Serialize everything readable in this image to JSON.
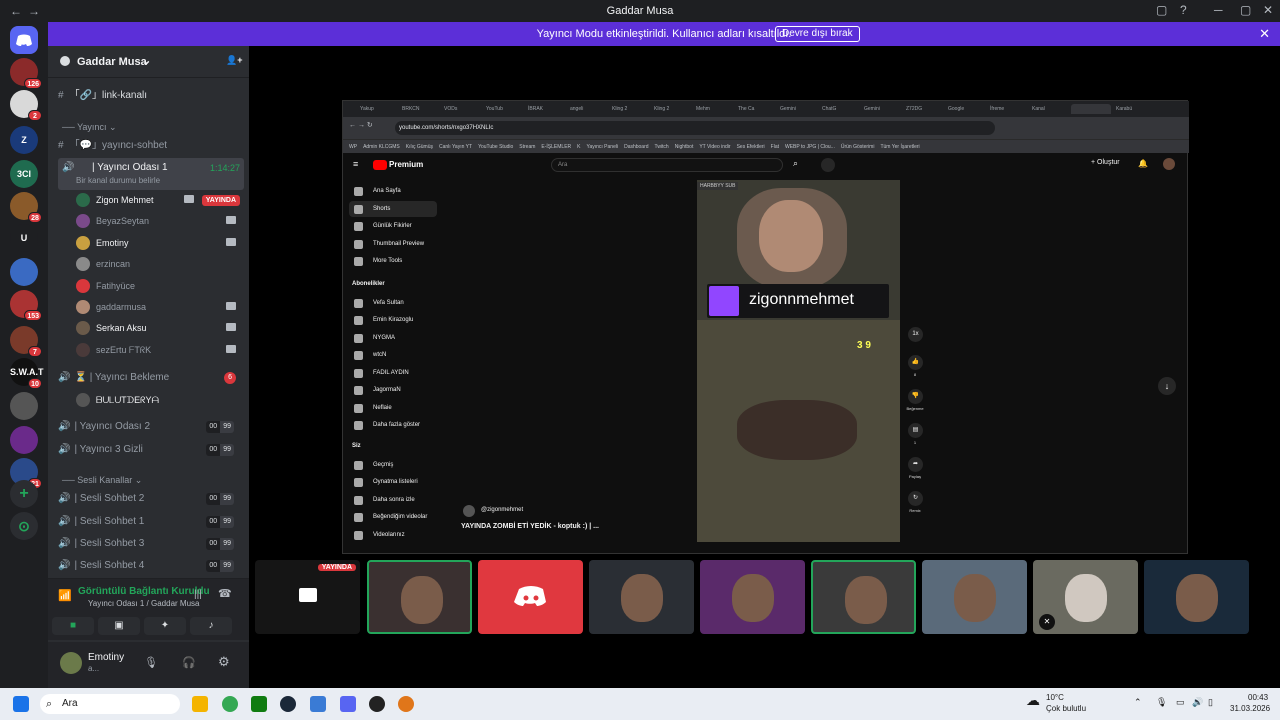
{
  "window": {
    "title": "Gaddar Musa",
    "back": "←",
    "forward": "→",
    "controls": [
      "▢",
      "?",
      "─",
      "▢",
      "✕"
    ]
  },
  "banner": {
    "text": "Yayıncı Modu etkinleştirildi. Kullanıcı adları kısaltıldı.",
    "button": "Devre dışı bırak",
    "close": "✕"
  },
  "servers": [
    {
      "label": "",
      "color": "#5865f2",
      "badge": ""
    },
    {
      "label": "",
      "color": "#8b2a2a",
      "badge": "126"
    },
    {
      "label": "",
      "color": "#d9d9d9",
      "badge": "2"
    },
    {
      "label": "Z",
      "color": "#1a3a7a",
      "badge": ""
    },
    {
      "label": "3CI",
      "color": "#1f6b4f",
      "badge": ""
    },
    {
      "label": "",
      "color": "#8a5a2a",
      "badge": "28"
    },
    {
      "label": "U",
      "color": "#1e1f22",
      "badge": ""
    },
    {
      "label": "",
      "color": "#3a6ac2",
      "badge": ""
    },
    {
      "label": "",
      "color": "#a33",
      "badge": "153"
    },
    {
      "label": "",
      "color": "#7a3a2a",
      "badge": "7"
    },
    {
      "label": "S.W.A.T",
      "color": "#111",
      "badge": "10"
    },
    {
      "label": "",
      "color": "#555",
      "badge": ""
    },
    {
      "label": "",
      "color": "#6a2a8a",
      "badge": ""
    },
    {
      "label": "",
      "color": "#2a4a8a",
      "badge": "21"
    }
  ],
  "rail_actions": {
    "add": "+",
    "discover": "⊙"
  },
  "guild": {
    "name": "Gaddar Musa",
    "chevron": "⌄",
    "invite_icon": "👤+"
  },
  "channels": {
    "link": "「🔗」link-kanalı",
    "cat_yayinci": "Yayıncı",
    "sohbet": "「💬」yayıncı-sohbet",
    "active_room": "| Yayıncı Odası 1",
    "active_time": "1:14:27",
    "active_status": "Bir kanal durumu belirle",
    "bekleme": "| Yayıncı Bekleme",
    "bekleme_count": "6",
    "bekleme_user": "ᗷᑌᒪᑌTᗪEᖇYᗩ",
    "oda2": "| Yayıncı Odası 2",
    "gizli": "| Yayıncı 3 Gizli",
    "cat_sesli": "Sesli Kanallar",
    "s2": "| Sesli Sohbet 2",
    "s1": "| Sesli Sohbet 1",
    "s3": "| Sesli Sohbet 3",
    "s4": "| Sesli Sohbet 4",
    "count_a": "00",
    "count_b": "99"
  },
  "users": [
    {
      "name": "Zigon Mehmet",
      "bright": true,
      "live": "YAYINDA",
      "color": "#2b6a4a"
    },
    {
      "name": "BeyazSeytan",
      "bright": false,
      "live": "",
      "color": "#7a4a8a"
    },
    {
      "name": "Emotiny",
      "bright": true,
      "live": "",
      "color": "#c9a040"
    },
    {
      "name": "erzincan",
      "bright": false,
      "live": "",
      "color": "#8a8a8a"
    },
    {
      "name": "Fatihyüce",
      "bright": false,
      "live": "",
      "color": "#da373c"
    },
    {
      "name": "gaddarmusa",
      "bright": false,
      "live": "",
      "color": "#b08a74"
    },
    {
      "name": "Serkan Aksu",
      "bright": true,
      "live": "",
      "color": "#6a5a4a"
    },
    {
      "name": "sezErtu ᖴTᖇK",
      "bright": false,
      "live": "",
      "color": "#4a3a3a"
    }
  ],
  "voice": {
    "status": "Görüntülü Bağlantı Kuruldu",
    "location": "Yayıncı Odası 1 / Gaddar Musa"
  },
  "me": {
    "name": "Emotiny",
    "sub": "a..."
  },
  "browser": {
    "tabs": [
      "Yakup",
      "BRKCN",
      "VODs",
      "YouTub",
      "İBRAK",
      "angeli",
      "Kling 2",
      "Kling 2",
      "Mehm",
      "The Ca",
      "Gemini",
      "ChatG",
      "Gemini",
      "Z72DG",
      "Google",
      "İfreme",
      "Kanal",
      "",
      "Karabü"
    ],
    "url": "youtube.com/shorts/nxgo37HXNLIc",
    "bookmarks": [
      "WP",
      "Admin KLCGMS",
      "Kılıç Gümüş",
      "Canlı Yayın YT",
      "YouTube Studio",
      "Stream",
      "E-İŞLEMLER",
      "K",
      "Yayıncı Paneli",
      "Dashboard",
      "Twitch",
      "Nightbot",
      "YT Video indir",
      "Ses Efektleri",
      "Flat",
      "WEBP to JPG | Clou...",
      "Ürün Gösterimi",
      "Tüm Yer İşaretleri"
    ]
  },
  "youtube": {
    "logo": "Premium",
    "search": "Ara",
    "create": "Oluştur",
    "nav": [
      "Ana Sayfa",
      "Shorts",
      "Günlük Fikirler",
      "Thumbnail Preview",
      "More Tools"
    ],
    "subs_title": "Abonelikler",
    "subs": [
      "Vefa Sultan",
      "Emin Kirazoglu",
      "NYGMA",
      "wtcN",
      "FADIL AYDIN",
      "JagormaN",
      "Neflaie",
      "Daha fazla göster"
    ],
    "you_title": "Siz",
    "you": [
      "Geçmiş",
      "Oynatma listeleri",
      "Daha sonra izle",
      "Beğendiğim videolar",
      "Videolarınız"
    ],
    "channel": "@zigonmehmet",
    "title": "YAYINDA ZOMBİ ETİ YEDİK - koptuk :) | ...",
    "overlay_name": "zigonnmehmet",
    "sub_tag": "HARBBYY SUB",
    "score": "3 9",
    "actions": {
      "speed": "1x",
      "likes": "8",
      "dislike": "Beğenme",
      "comments": "1",
      "share": "Paylaş",
      "remix": "Remix"
    }
  },
  "thumbs": {
    "live": "YAYINDA"
  },
  "taskbar": {
    "search": "Ara",
    "weather_temp": "10°C",
    "weather_desc": "Çok bulutlu",
    "time": "00:43",
    "date": "31.03.2026"
  }
}
